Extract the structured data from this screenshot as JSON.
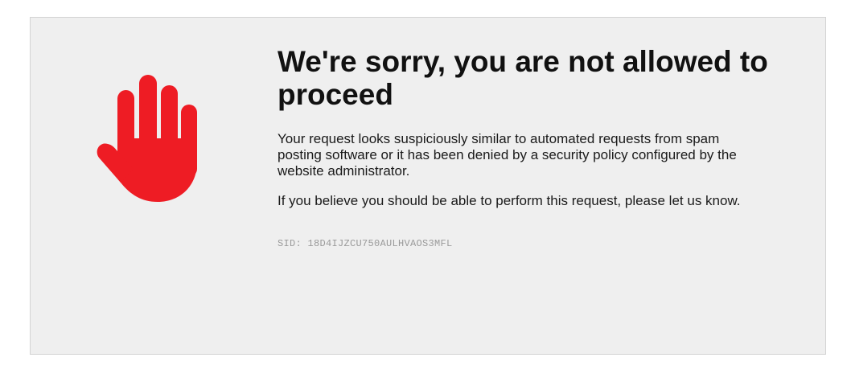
{
  "error_page": {
    "title": "We're sorry, you are not allowed to proceed",
    "message_1": "Your request looks suspiciously similar to automated requests from spam posting software or it has been denied by a security policy configured by the website administrator.",
    "message_2": "If you believe you should be able to perform this request, please let us know.",
    "sid": "SID: 18D4IJZCU750AULHVAOS3MFL",
    "icon": "stop-hand-icon",
    "accent_color": "#ee1c24",
    "background_color": "#efefef"
  }
}
